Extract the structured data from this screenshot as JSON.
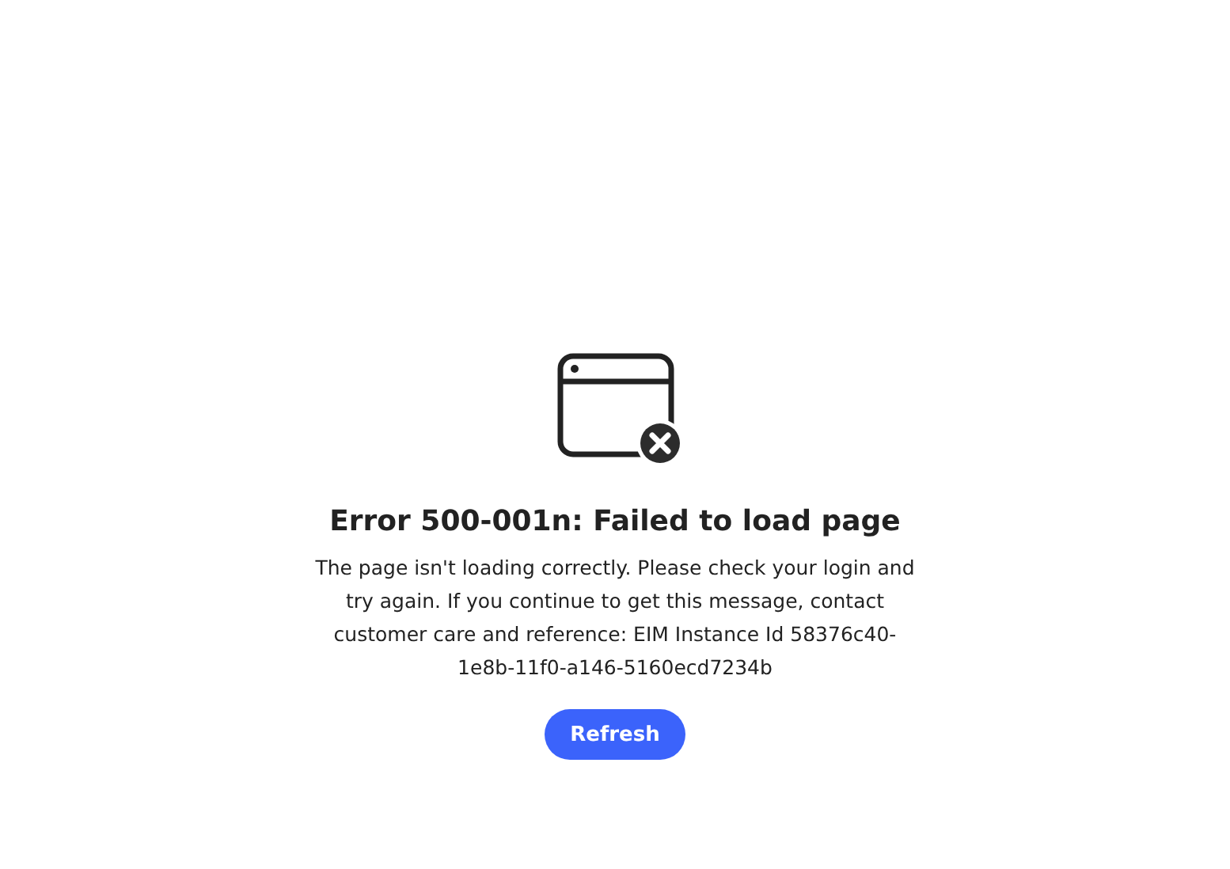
{
  "error": {
    "title": "Error 500-001n: Failed to load page",
    "message": "The page isn't loading correctly. Please check your login and try again. If you continue to get this message, contact customer care and reference: EIM Instance Id 58376c40-1e8b-11f0-a146-5160ecd7234b",
    "button": "Refresh"
  }
}
